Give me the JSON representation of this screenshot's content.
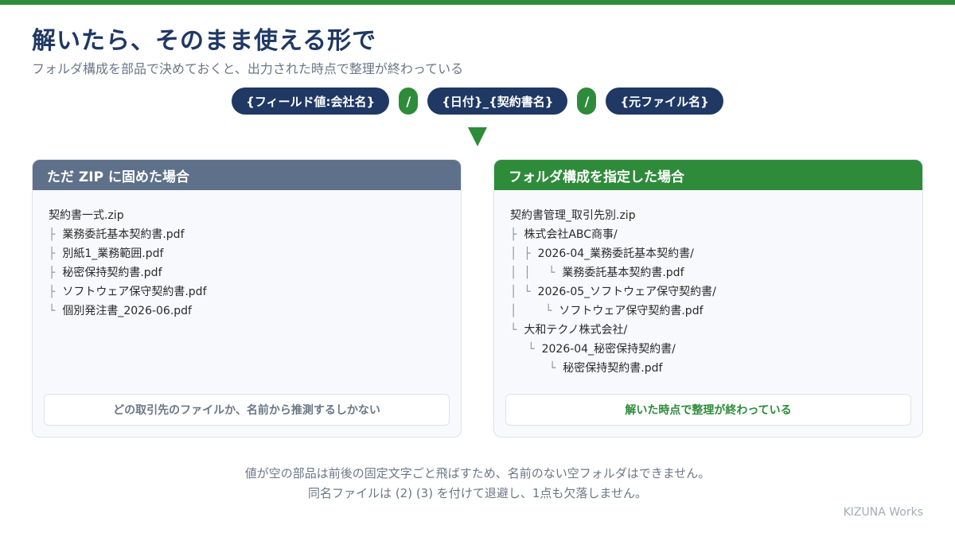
{
  "title": "解いたら、そのまま使える形で",
  "subtitle": "フォルダ構成を部品で決めておくと、出力された時点で整理が終わっている",
  "pattern": {
    "part1": "{フィールド値:会社名}",
    "sep1": "/",
    "part2": "{日付}_{契約書名}",
    "sep2": "/",
    "part3": "{元ファイル名}"
  },
  "left_panel": {
    "header": "ただ ZIP に固めた場合",
    "rows": [
      {
        "guide": "",
        "name": "契約書一式.zip"
      },
      {
        "guide": "├  ",
        "name": "業務委託基本契約書.pdf"
      },
      {
        "guide": "├  ",
        "name": "別紙1_業務範囲.pdf"
      },
      {
        "guide": "├  ",
        "name": "秘密保持契約書.pdf"
      },
      {
        "guide": "├  ",
        "name": "ソフトウェア保守契約書.pdf"
      },
      {
        "guide": "└  ",
        "name": "個別発注書_2026-06.pdf"
      }
    ],
    "note": "どの取引先のファイルか、名前から推測するしかない"
  },
  "right_panel": {
    "header": "フォルダ構成を指定した場合",
    "rows": [
      {
        "guide": "",
        "name": "契約書管理_取引先別.zip"
      },
      {
        "guide": "├  ",
        "name": "株式会社ABC商事/"
      },
      {
        "guide": "│  ├  ",
        "name": "2026-04_業務委託基本契約書/"
      },
      {
        "guide": "│  │     └  ",
        "name": "業務委託基本契約書.pdf"
      },
      {
        "guide": "│  └  ",
        "name": "2026-05_ソフトウェア保守契約書/"
      },
      {
        "guide": "│        └  ",
        "name": "ソフトウェア保守契約書.pdf"
      },
      {
        "guide": "└  ",
        "name": "大和テクノ株式会社/"
      },
      {
        "guide": "     └  ",
        "name": "2026-04_秘密保持契約書/"
      },
      {
        "guide": "           └  ",
        "name": "秘密保持契約書.pdf"
      }
    ],
    "note": "解いた時点で整理が終わっている"
  },
  "footer": {
    "line1": "値が空の部品は前後の固定文字ごと飛ばすため、名前のない空フォルダはできません。",
    "line2": "同名ファイルは (2) (3) を付けて退避し、1点も欠落しません。"
  },
  "brand": "KIZUNA Works",
  "colors": {
    "navy": "#1f3864",
    "green": "#2e8b3a",
    "slate": "#5f708a"
  }
}
